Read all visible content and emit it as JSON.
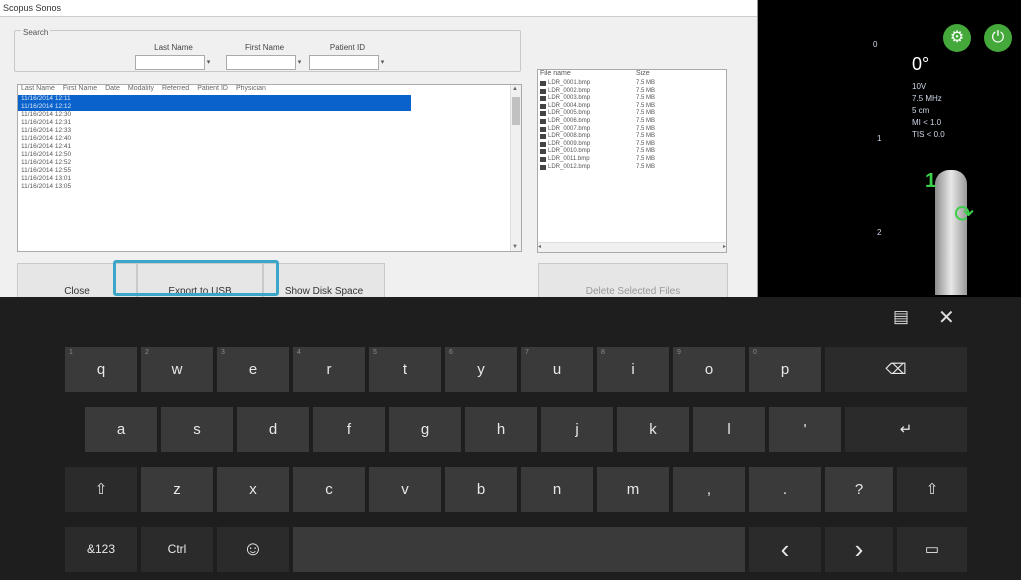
{
  "window": {
    "title": "Scopus Sonos"
  },
  "search": {
    "group_label": "Search",
    "fields": [
      {
        "label": "Last Name"
      },
      {
        "label": "First Name"
      },
      {
        "label": "Patient ID"
      }
    ]
  },
  "studies": {
    "columns": [
      "Last Name",
      "First Name",
      "Date",
      "Modality",
      "Referred",
      "Patient ID",
      "Physician"
    ],
    "rows": [
      "11/16/2014 12:11",
      "11/16/2014 12:12",
      "11/16/2014 12:30",
      "11/16/2014 12:31",
      "11/16/2014 12:33",
      "11/16/2014 12:40",
      "11/16/2014 12:41",
      "11/16/2014 12:50",
      "11/16/2014 12:52",
      "11/16/2014 12:55",
      "11/16/2014 13:01",
      "11/16/2014 13:05"
    ],
    "selected": [
      0,
      1
    ]
  },
  "files": {
    "columns": [
      "File name",
      "Size"
    ],
    "rows": [
      {
        "name": "LDR_0001.bmp",
        "size": "7.5 MB"
      },
      {
        "name": "LDR_0002.bmp",
        "size": "7.5 MB"
      },
      {
        "name": "LDR_0003.bmp",
        "size": "7.5 MB"
      },
      {
        "name": "LDR_0004.bmp",
        "size": "7.5 MB"
      },
      {
        "name": "LDR_0005.bmp",
        "size": "7.5 MB"
      },
      {
        "name": "LDR_0006.bmp",
        "size": "7.5 MB"
      },
      {
        "name": "LDR_0007.bmp",
        "size": "7.5 MB"
      },
      {
        "name": "LDR_0008.bmp",
        "size": "7.5 MB"
      },
      {
        "name": "LDR_0009.bmp",
        "size": "7.5 MB"
      },
      {
        "name": "LDR_0010.bmp",
        "size": "7.5 MB"
      },
      {
        "name": "LDR_0011.bmp",
        "size": "7.5 MB"
      },
      {
        "name": "LDR_0012.bmp",
        "size": "7.5 MB"
      }
    ]
  },
  "buttons": {
    "close": "Close",
    "export": "Export to USB",
    "disk": "Show Disk Space",
    "delete": "Delete Selected Files"
  },
  "scan_panel": {
    "angle": "0°",
    "info": [
      "10V",
      "7.5 MHz",
      "5 cm",
      "MI < 1.0",
      "TIS < 0.0"
    ],
    "depth_top": "0",
    "depth_mid": "1",
    "depth_low": "2",
    "probe_marker": "1"
  },
  "keyboard": {
    "row1": [
      {
        "k": "q",
        "h": "1"
      },
      {
        "k": "w",
        "h": "2"
      },
      {
        "k": "e",
        "h": "3"
      },
      {
        "k": "r",
        "h": "4"
      },
      {
        "k": "t",
        "h": "5"
      },
      {
        "k": "y",
        "h": "6"
      },
      {
        "k": "u",
        "h": "7"
      },
      {
        "k": "i",
        "h": "8"
      },
      {
        "k": "o",
        "h": "9"
      },
      {
        "k": "p",
        "h": "0"
      }
    ],
    "row2": [
      "a",
      "s",
      "d",
      "f",
      "g",
      "h",
      "j",
      "k",
      "l",
      "'"
    ],
    "row3": [
      "z",
      "x",
      "c",
      "v",
      "b",
      "n",
      "m",
      ",",
      ".",
      "?"
    ],
    "backspace": "⌫",
    "enter": "↵",
    "shift": "⇧",
    "symbols": "&123",
    "ctrl": "Ctrl",
    "emoji": "☺",
    "left": "‹",
    "right": "›",
    "layout": "▭",
    "close": "✕",
    "dock": "▤"
  }
}
